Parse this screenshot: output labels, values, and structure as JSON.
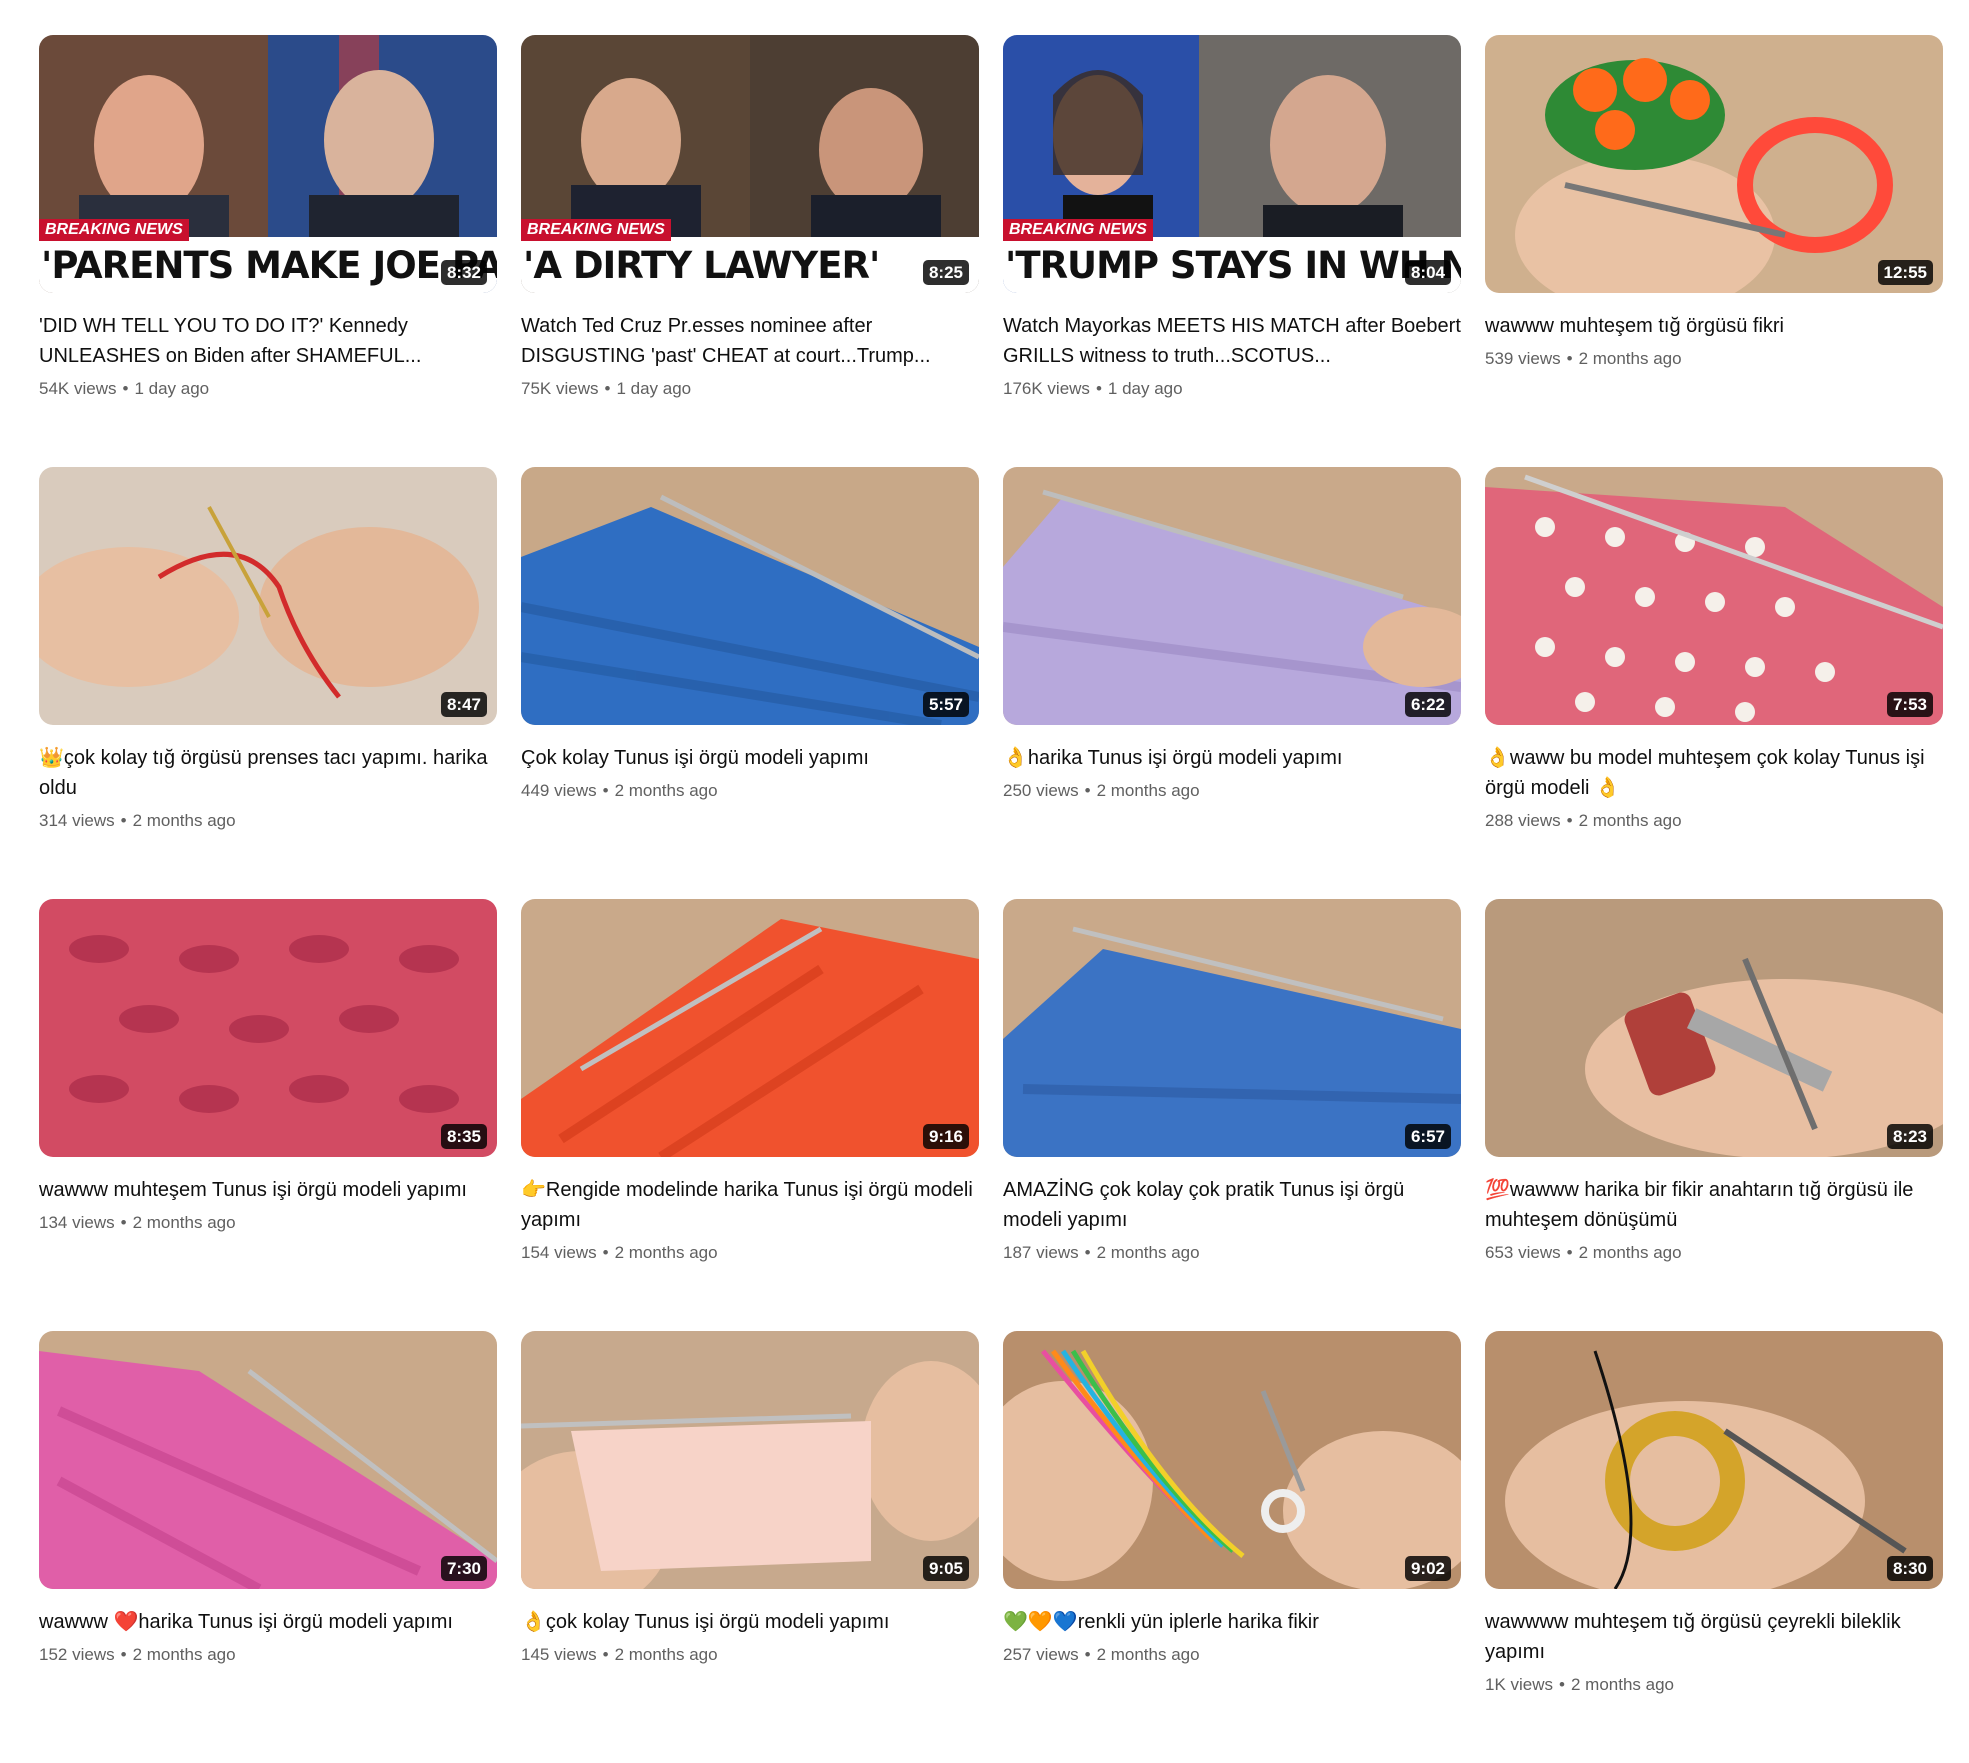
{
  "videos": [
    {
      "title": "'DID WH TELL YOU TO DO IT?' Kennedy UNLEASHES on Biden after SHAMEFUL...",
      "views": "54K views",
      "age": "1 day ago",
      "duration": "8:32",
      "overlay": {
        "breaking": "BREAKING NEWS",
        "headline": "'PARENTS MAKE JOE PAY"
      }
    },
    {
      "title": "Watch Ted Cruz Pr.esses nominee after DISGUSTING 'past' CHEAT at court...Trump...",
      "views": "75K views",
      "age": "1 day ago",
      "duration": "8:25",
      "overlay": {
        "breaking": "BREAKING NEWS",
        "headline": "'A DIRTY LAWYER'"
      }
    },
    {
      "title": "Watch Mayorkas MEETS HIS MATCH after Boebert GRILLS witness to truth...SCOTUS...",
      "views": "176K views",
      "age": "1 day ago",
      "duration": "8:04",
      "overlay": {
        "breaking": "BREAKING NEWS",
        "headline": "'TRUMP STAYS IN WH NOW'"
      }
    },
    {
      "title": "wawww muhteşem tığ örgüsü fikri",
      "views": "539 views",
      "age": "2 months ago",
      "duration": "12:55"
    },
    {
      "title": "👑çok kolay tığ örgüsü prenses tacı yapımı. harika oldu",
      "views": "314 views",
      "age": "2 months ago",
      "duration": "8:47"
    },
    {
      "title": "Çok kolay Tunus işi örgü modeli yapımı",
      "views": "449 views",
      "age": "2 months ago",
      "duration": "5:57"
    },
    {
      "title": "👌harika Tunus işi örgü modeli yapımı",
      "views": "250 views",
      "age": "2 months ago",
      "duration": "6:22"
    },
    {
      "title": "👌waww bu model muhteşem çok kolay Tunus işi örgü modeli 👌",
      "views": "288 views",
      "age": "2 months ago",
      "duration": "7:53"
    },
    {
      "title": "wawww muhteşem Tunus işi örgü modeli yapımı",
      "views": "134 views",
      "age": "2 months ago",
      "duration": "8:35"
    },
    {
      "title": "👉Rengide modelinde harika Tunus işi örgü modeli yapımı",
      "views": "154 views",
      "age": "2 months ago",
      "duration": "9:16"
    },
    {
      "title": "AMAZİNG çok kolay çok pratik Tunus işi örgü modeli yapımı",
      "views": "187 views",
      "age": "2 months ago",
      "duration": "6:57"
    },
    {
      "title": "💯wawww harika bir fikir anahtarın tığ örgüsü ile muhteşem dönüşümü",
      "views": "653 views",
      "age": "2 months ago",
      "duration": "8:23"
    },
    {
      "title": "wawww ❤️harika Tunus işi örgü modeli yapımı",
      "views": "152 views",
      "age": "2 months ago",
      "duration": "7:30"
    },
    {
      "title": "👌çok kolay Tunus işi örgü modeli yapımı",
      "views": "145 views",
      "age": "2 months ago",
      "duration": "9:05"
    },
    {
      "title": "💚🧡💙renkli yün iplerle harika fikir",
      "views": "257 views",
      "age": "2 months ago",
      "duration": "9:02"
    },
    {
      "title": "wawwww muhteşem tığ örgüsü çeyrekli bileklik yapımı",
      "views": "1K views",
      "age": "2 months ago",
      "duration": "8:30"
    }
  ]
}
